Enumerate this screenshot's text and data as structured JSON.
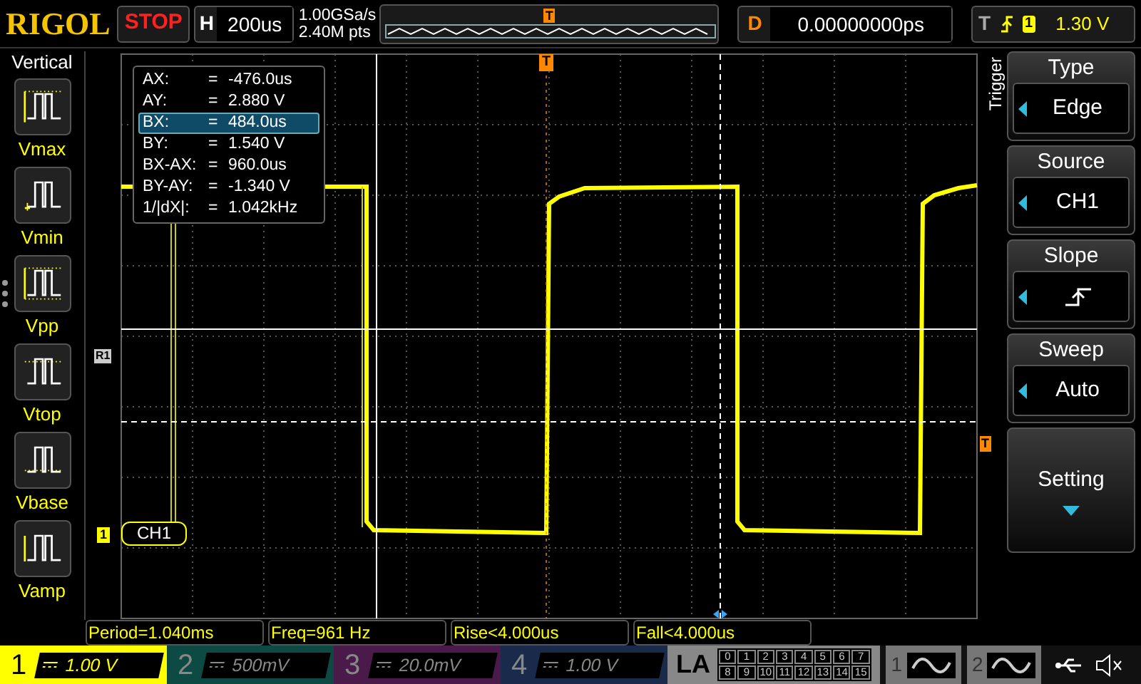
{
  "brand": "RIGOL",
  "run_state": "STOP",
  "timebase": {
    "label": "H",
    "value": "200us"
  },
  "sample": {
    "rate": "1.00GSa/s",
    "depth": "2.40M pts"
  },
  "overview_marker": "T",
  "delay": {
    "label": "D",
    "value": "0.00000000ps"
  },
  "trigger_status": {
    "label": "T",
    "source": "1",
    "level": "1.30 V"
  },
  "left_menu": {
    "title": "Vertical",
    "items": [
      {
        "label": "Vmax"
      },
      {
        "label": "Vmin"
      },
      {
        "label": "Vpp"
      },
      {
        "label": "Vtop"
      },
      {
        "label": "Vbase"
      },
      {
        "label": "Vamp"
      }
    ]
  },
  "plot": {
    "top_trigger_marker": "T",
    "right_trigger_marker": "T",
    "ref_marker": "R1",
    "channel_number": "1",
    "channel_label": "CH1"
  },
  "cursor_readout": [
    {
      "name": "AX:",
      "eq": "=",
      "value": "-476.0us",
      "selected": false
    },
    {
      "name": "AY:",
      "eq": "=",
      "value": "2.880 V",
      "selected": false
    },
    {
      "name": "BX:",
      "eq": "=",
      "value": "484.0us",
      "selected": true
    },
    {
      "name": "BY:",
      "eq": "=",
      "value": "1.540 V",
      "selected": false
    },
    {
      "name": "BX-AX:",
      "eq": "=",
      "value": "960.0us",
      "selected": false
    },
    {
      "name": "BY-AY:",
      "eq": "=",
      "value": "-1.340 V",
      "selected": false
    },
    {
      "name": "1/|dX|:",
      "eq": "=",
      "value": "1.042kHz",
      "selected": false
    }
  ],
  "right_menu": {
    "title": "Trigger",
    "items": [
      {
        "title": "Type",
        "kind": "value",
        "value": "Edge"
      },
      {
        "title": "Source",
        "kind": "value",
        "value": "CH1"
      },
      {
        "title": "Slope",
        "kind": "slope"
      },
      {
        "title": "Sweep",
        "kind": "value",
        "value": "Auto"
      },
      {
        "title": "Setting",
        "kind": "submenu"
      }
    ]
  },
  "measurements": [
    "Period=1.040ms",
    "Freq=961 Hz",
    "Rise<4.000us",
    "Fall<4.000us"
  ],
  "channels": [
    {
      "number": "1",
      "scale": "1.00 V",
      "selected": true,
      "color": "#ffff00"
    },
    {
      "number": "2",
      "scale": "500mV",
      "selected": false,
      "color": "#0e4a44"
    },
    {
      "number": "3",
      "scale": "20.0mV",
      "selected": false,
      "color": "#4a1a4a"
    },
    {
      "number": "4",
      "scale": "1.00 V",
      "selected": false,
      "color": "#1a2a4a"
    }
  ],
  "la": {
    "label": "LA",
    "bits": [
      "0",
      "1",
      "2",
      "3",
      "4",
      "5",
      "6",
      "7",
      "8",
      "9",
      "10",
      "11",
      "12",
      "13",
      "14",
      "15"
    ]
  },
  "generators": [
    {
      "number": "1"
    },
    {
      "number": "2"
    }
  ]
}
